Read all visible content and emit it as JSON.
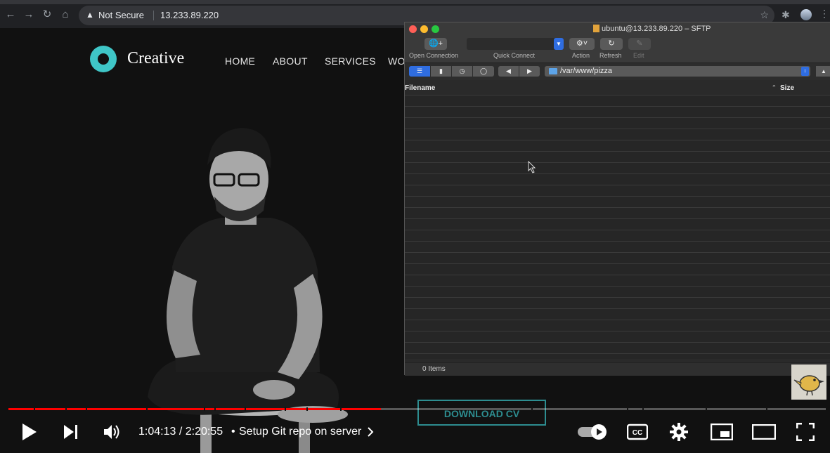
{
  "browser": {
    "security_label": "Not Secure",
    "url": "13.233.89.220",
    "icons": [
      "back-icon",
      "forward-icon",
      "reload-icon",
      "home-icon",
      "warning-icon",
      "star-icon",
      "extensions-icon",
      "profile-avatar",
      "menu-icon"
    ]
  },
  "website": {
    "brand": "Creative",
    "nav": [
      "HOME",
      "ABOUT",
      "SERVICES",
      "WO"
    ],
    "cta": "DOWNLOAD CV",
    "accent_color": "#3fc6c7"
  },
  "sftp": {
    "title": "ubuntu@13.233.89.220 – SFTP",
    "toolbar": {
      "open_connection": "Open Connection",
      "quick_connect": "Quick Connect",
      "action": "Action",
      "refresh": "Refresh",
      "edit": "Edit"
    },
    "path": "/var/www/pizza",
    "columns": {
      "filename": "Filename",
      "size": "Size"
    },
    "status": "0 Items"
  },
  "player": {
    "time": "1:04:13 / 2:20:55",
    "chapter": "Setup Git repo on server",
    "progress_fraction": 0.4557
  }
}
